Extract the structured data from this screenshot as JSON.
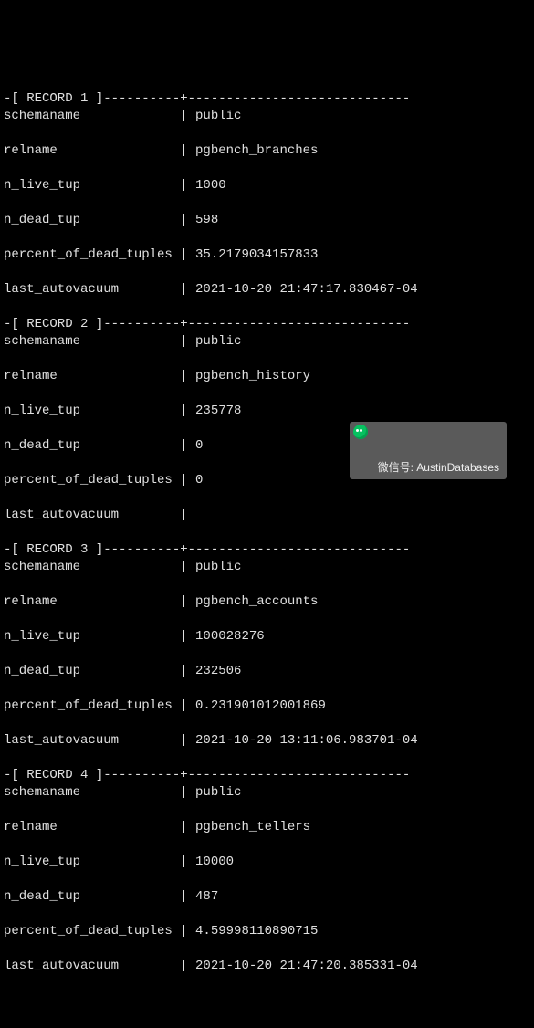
{
  "labels": {
    "schemaname": "schemaname",
    "relname": "relname",
    "n_live_tup": "n_live_tup",
    "n_dead_tup": "n_dead_tup",
    "percent_of_dead_tuples": "percent_of_dead_tuples",
    "last_autovacuum": "last_autovacuum"
  },
  "record_headers": [
    "-[ RECORD 1 ]----------+-----------------------------",
    "-[ RECORD 2 ]----------+-----------------------------",
    "-[ RECORD 3 ]----------+-----------------------------",
    "-[ RECORD 4 ]----------+-----------------------------"
  ],
  "records": [
    {
      "schemaname": "public",
      "relname": "pgbench_branches",
      "n_live_tup": "1000",
      "n_dead_tup": "598",
      "percent_of_dead_tuples": "35.2179034157833",
      "last_autovacuum": "2021-10-20 21:47:17.830467-04"
    },
    {
      "schemaname": "public",
      "relname": "pgbench_history",
      "n_live_tup": "235778",
      "n_dead_tup": "0",
      "percent_of_dead_tuples": "0",
      "last_autovacuum": ""
    },
    {
      "schemaname": "public",
      "relname": "pgbench_accounts",
      "n_live_tup": "100028276",
      "n_dead_tup": "232506",
      "percent_of_dead_tuples": "0.231901012001869",
      "last_autovacuum": "2021-10-20 13:11:06.983701-04"
    },
    {
      "schemaname": "public",
      "relname": "pgbench_tellers",
      "n_live_tup": "10000",
      "n_dead_tup": "487",
      "percent_of_dead_tuples": "4.59998110890715",
      "last_autovacuum": "2021-10-20 21:47:20.385331-04"
    }
  ],
  "watermark": "微信号: AustinDatabases"
}
